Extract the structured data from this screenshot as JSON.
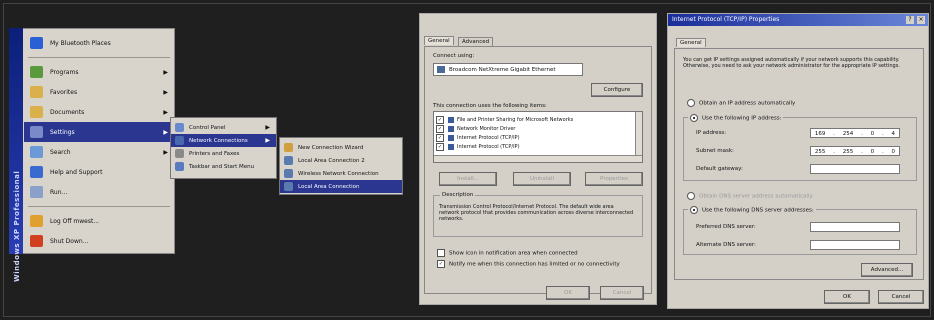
{
  "start_menu": {
    "sidebar_label": "Windows XP Professional",
    "items": [
      {
        "label": "My Bluetooth Places",
        "icon": "bluetooth-icon",
        "color": "#2a5fd6",
        "arrow": false
      },
      {
        "label": "Programs",
        "icon": "programs-folder-icon",
        "color": "#5a9a3a",
        "arrow": true
      },
      {
        "label": "Favorites",
        "icon": "favorites-folder-icon",
        "color": "#d9b04a",
        "arrow": true
      },
      {
        "label": "Documents",
        "icon": "documents-folder-icon",
        "color": "#d9b04a",
        "arrow": true
      },
      {
        "label": "Settings",
        "icon": "settings-icon",
        "color": "#7a8ac8",
        "arrow": true
      },
      {
        "label": "Search",
        "icon": "search-icon",
        "color": "#6a9ad6",
        "arrow": true
      },
      {
        "label": "Help and Support",
        "icon": "help-icon",
        "color": "#3a6ad0",
        "arrow": false
      },
      {
        "label": "Run...",
        "icon": "run-icon",
        "color": "#8aa0c8",
        "arrow": false
      },
      {
        "label": "Log Off mwest...",
        "icon": "logoff-icon",
        "color": "#e0a030",
        "arrow": false
      },
      {
        "label": "Shut Down...",
        "icon": "shutdown-icon",
        "color": "#d04020",
        "arrow": false
      }
    ]
  },
  "settings_menu": {
    "items": [
      "Control Panel",
      "Network Connections",
      "Printers and Faxes",
      "Taskbar and Start Menu"
    ]
  },
  "network_menu": {
    "items": [
      "New Connection Wizard",
      "Local Area Connection 2",
      "Wireless Network Connection",
      "Local Area Connection"
    ]
  },
  "lan_properties": {
    "tabs": [
      "General",
      "Advanced"
    ],
    "connect_using_label": "Connect using:",
    "adapter": "Broadcom NetXtreme Gigabit Ethernet",
    "configure_button": "Configure",
    "items_label": "This connection uses the following items:",
    "components": [
      "File and Printer Sharing for Microsoft Networks",
      "Network Monitor Driver",
      "Internet Protocol (TCP/IP)",
      "Internet Protocol (TCP/IP)"
    ],
    "install_button": "Install...",
    "uninstall_button": "Uninstall",
    "properties_button": "Properties",
    "description_title": "Description",
    "description_text": "Transmission Control Protocol/Internet Protocol. The default wide area network protocol that provides communication across diverse interconnected networks.",
    "show_icon_label": "Show icon in notification area when connected",
    "notify_label": "Notify me when this connection has limited or no connectivity",
    "ok_button": "OK",
    "cancel_button": "Cancel"
  },
  "tcpip_properties": {
    "title": "Internet Protocol (TCP/IP) Properties",
    "tab": "General",
    "intro": "You can get IP settings assigned automatically if your network supports this capability. Otherwise, you need to ask your network administrator for the appropriate IP settings.",
    "auto_ip_label": "Obtain an IP address automatically",
    "use_ip_label": "Use the following IP address:",
    "ip_label": "IP address:",
    "ip_value": [
      "169",
      "254",
      "0",
      "4"
    ],
    "subnet_label": "Subnet mask:",
    "subnet_value": [
      "255",
      "255",
      "0",
      "0"
    ],
    "gateway_label": "Default gateway:",
    "auto_dns_label": "Obtain DNS server address automatically",
    "use_dns_label": "Use the following DNS server addresses:",
    "preferred_dns_label": "Preferred DNS server:",
    "alternate_dns_label": "Alternate DNS server:",
    "advanced_button": "Advanced...",
    "ok_button": "OK",
    "cancel_button": "Cancel"
  }
}
